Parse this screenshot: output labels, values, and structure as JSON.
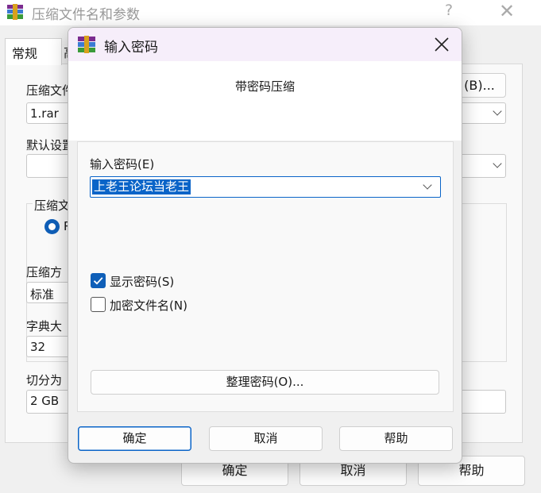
{
  "parent_window": {
    "title": "压缩文件名和参数",
    "help_glyph": "?",
    "close_glyph": "✕",
    "tabs": [
      {
        "label": "常规"
      },
      {
        "label": "高"
      }
    ],
    "archive_name_label": "压缩文件",
    "archive_name_value": "1.rar",
    "browse_button": "(B)...",
    "default_settings_label": "默认设置",
    "format_group_label": "压缩文",
    "format_option": "R",
    "method_label": "压缩方",
    "method_value": "标准",
    "dict_label": "字典大",
    "dict_value": "32",
    "split_label": "切分为",
    "split_value": "2 GB",
    "ok_button": "确定",
    "cancel_button": "取消",
    "help_button": "帮助"
  },
  "dialog": {
    "title": "输入密码",
    "subtitle": "带密码压缩",
    "password_label": "输入密码(E)",
    "password_value": "上老王论坛当老王",
    "show_password": {
      "label": "显示密码(S)",
      "checked": true
    },
    "encrypt_filenames": {
      "label": "加密文件名(N)",
      "checked": false
    },
    "organize_button": "整理密码(O)...",
    "ok_button": "确定",
    "cancel_button": "取消",
    "help_button": "帮助"
  },
  "colors": {
    "accent": "#0a64c8",
    "checkbox_fill": "#0f5fb8",
    "titlebar_tint": "#f6eefa"
  },
  "icons": [
    "winrar-app-icon",
    "close-icon",
    "chevron-down-icon",
    "checkmark-icon",
    "help-icon"
  ]
}
